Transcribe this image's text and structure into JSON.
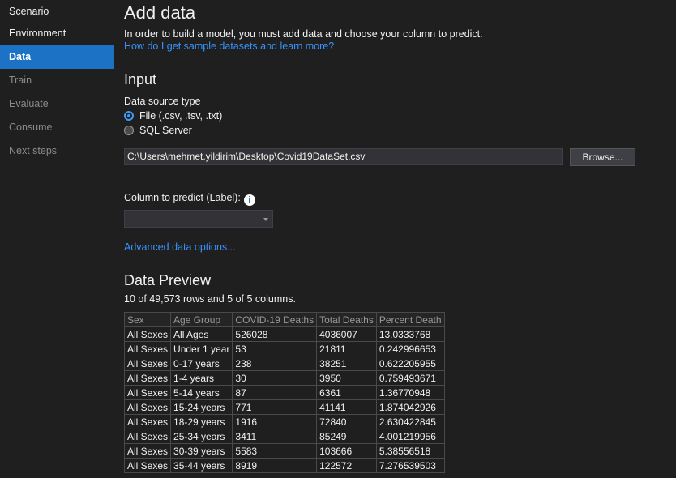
{
  "sidebar": {
    "items": [
      {
        "label": "Scenario",
        "state": "done"
      },
      {
        "label": "Environment",
        "state": "done"
      },
      {
        "label": "Data",
        "state": "active"
      },
      {
        "label": "Train",
        "state": "pending"
      },
      {
        "label": "Evaluate",
        "state": "pending"
      },
      {
        "label": "Consume",
        "state": "pending"
      },
      {
        "label": "Next steps",
        "state": "pending"
      }
    ]
  },
  "page": {
    "title": "Add data",
    "description": "In order to build a model, you must add data and choose your column to predict.",
    "sample_link": "How do I get sample datasets and learn more?"
  },
  "input": {
    "heading": "Input",
    "source_label": "Data source type",
    "options": [
      {
        "label": "File (.csv, .tsv, .txt)",
        "selected": true
      },
      {
        "label": "SQL Server",
        "selected": false
      }
    ],
    "file_path": "C:\\Users\\mehmet.yildirim\\Desktop\\Covid19DataSet.csv",
    "browse_label": "Browse...",
    "column_label": "Column to predict (Label):",
    "column_value": "",
    "advanced_link": "Advanced data options..."
  },
  "preview": {
    "heading": "Data Preview",
    "summary": "10 of 49,573 rows and 5 of 5 columns.",
    "columns": [
      "Sex",
      "Age Group",
      "COVID-19 Deaths",
      "Total Deaths",
      "Percent Death"
    ],
    "rows": [
      [
        "All Sexes",
        "All Ages",
        "526028",
        "4036007",
        "13.0333768"
      ],
      [
        "All Sexes",
        "Under 1 year",
        "53",
        "21811",
        "0.242996653"
      ],
      [
        "All Sexes",
        "0-17 years",
        "238",
        "38251",
        "0.622205955"
      ],
      [
        "All Sexes",
        "1-4 years",
        "30",
        "3950",
        "0.759493671"
      ],
      [
        "All Sexes",
        "5-14 years",
        "87",
        "6361",
        "1.36770948"
      ],
      [
        "All Sexes",
        "15-24 years",
        "771",
        "41141",
        "1.874042926"
      ],
      [
        "All Sexes",
        "18-29 years",
        "1916",
        "72840",
        "2.630422845"
      ],
      [
        "All Sexes",
        "25-34 years",
        "3411",
        "85249",
        "4.001219956"
      ],
      [
        "All Sexes",
        "30-39 years",
        "5583",
        "103666",
        "5.38556518"
      ],
      [
        "All Sexes",
        "35-44 years",
        "8919",
        "122572",
        "7.276539503"
      ]
    ]
  },
  "colors": {
    "background": "#1f1f1f",
    "accent": "#1c72c4",
    "link": "#3794ff"
  }
}
